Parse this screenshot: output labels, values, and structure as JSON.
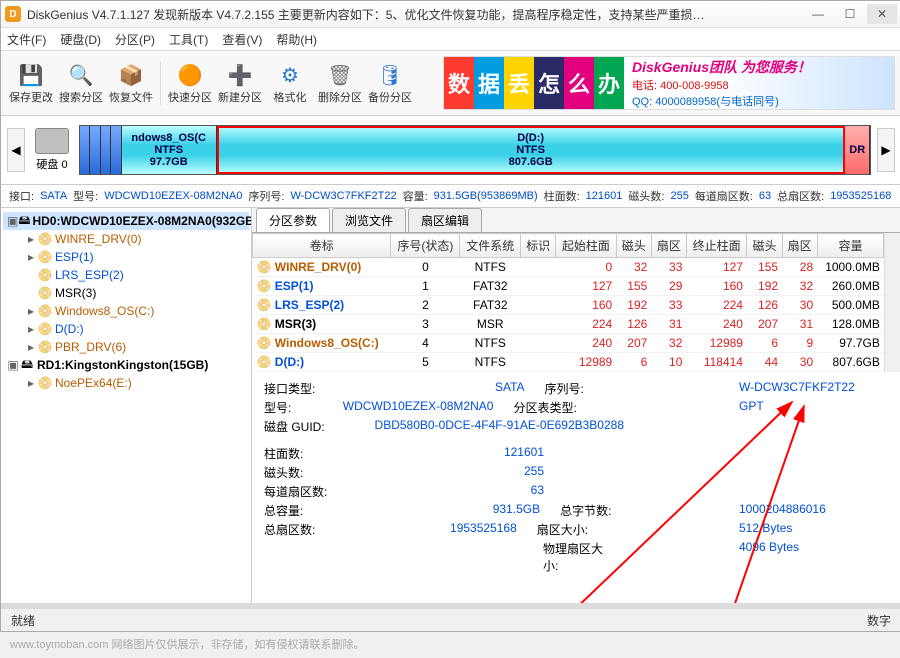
{
  "title": "DiskGenius V4.7.1.127   发现新版本 V4.7.2.155 主要更新内容如下：5、优化文件恢复功能，提高程序稳定性，支持某些严重损…",
  "menu": [
    "文件(F)",
    "硬盘(D)",
    "分区(P)",
    "工具(T)",
    "查看(V)",
    "帮助(H)"
  ],
  "toolbar": [
    {
      "label": "保存更改",
      "color": "#188a00",
      "glyph": "💾"
    },
    {
      "label": "搜索分区",
      "color": "#d76b00",
      "glyph": "🔍"
    },
    {
      "label": "恢复文件",
      "color": "#8a3a00",
      "glyph": "📦"
    },
    {
      "label": "快速分区",
      "color": "#d76b00",
      "glyph": "🟠"
    },
    {
      "label": "新建分区",
      "color": "#2a7ad1",
      "glyph": "➕"
    },
    {
      "label": "格式化",
      "color": "#2a7ad1",
      "glyph": "⚙"
    },
    {
      "label": "删除分区",
      "color": "#777",
      "glyph": "🗑"
    },
    {
      "label": "备份分区",
      "color": "#2a7ad1",
      "glyph": "🛢"
    }
  ],
  "banner": {
    "chars": [
      {
        "t": "数",
        "bg": "#ff3b30"
      },
      {
        "t": "据",
        "bg": "#009de0"
      },
      {
        "t": "丢",
        "bg": "#ffd400"
      },
      {
        "t": "怎",
        "bg": "#2a2a66"
      },
      {
        "t": "么",
        "bg": "#e3007e"
      },
      {
        "t": "办",
        "bg": "#00a651"
      }
    ],
    "l1": "DiskGenius团队 为您服务！",
    "l2": "电话: 400-008-9958",
    "l3": "QQ: 4000089958(与电话同号)"
  },
  "disklabel": "硬盘 0",
  "segments": [
    {
      "name": "",
      "sub": "",
      "w": "1.2%",
      "cls": "small"
    },
    {
      "name": "",
      "sub": "",
      "w": "1.2%",
      "cls": "small"
    },
    {
      "name": "",
      "sub": "",
      "w": "1.2%",
      "cls": "small"
    },
    {
      "name": "",
      "sub": "",
      "w": "1.2%",
      "cls": "small"
    },
    {
      "name": "ndows8_OS(C",
      "sub": "NTFS",
      "size": "97.7GB",
      "w": "12%",
      "cls": ""
    },
    {
      "name": "D(D:)",
      "sub": "NTFS",
      "size": "807.6GB",
      "w": "80%",
      "cls": "sel"
    },
    {
      "name": "DR",
      "sub": "",
      "size": "",
      "w": "3%",
      "cls": "end"
    }
  ],
  "infoline": {
    "iface_l": "接口:",
    "iface": "SATA",
    "model_l": "型号:",
    "model": "WDCWD10EZEX-08M2NA0",
    "serial_l": "序列号:",
    "serial": "W-DCW3C7FKF2T22",
    "cap_l": "容量:",
    "cap": "931.5GB(953869MB)",
    "cyl_l": "柱面数:",
    "cyl": "121601",
    "head_l": "磁头数:",
    "head": "255",
    "spt_l": "每道扇区数:",
    "spt": "63",
    "tot_l": "总扇区数:",
    "tot": "1953525168"
  },
  "tree": [
    {
      "ind": 0,
      "tw": "▣",
      "ic": "🖴",
      "txt": "HD0:WDCWD10EZEX-08M2NA0(932GB)",
      "bold": true,
      "sel": true
    },
    {
      "ind": 1,
      "tw": "▸",
      "ic": "📀",
      "txt": "WINRE_DRV(0)",
      "color": "#b85c00"
    },
    {
      "ind": 1,
      "tw": "▸",
      "ic": "📀",
      "txt": "ESP(1)",
      "color": "#0050d8"
    },
    {
      "ind": 1,
      "tw": "",
      "ic": "📀",
      "txt": "LRS_ESP(2)",
      "color": "#0050d8"
    },
    {
      "ind": 1,
      "tw": "",
      "ic": "📀",
      "txt": "MSR(3)",
      "color": "#000"
    },
    {
      "ind": 1,
      "tw": "▸",
      "ic": "📀",
      "txt": "Windows8_OS(C:)",
      "color": "#b85c00"
    },
    {
      "ind": 1,
      "tw": "▸",
      "ic": "📀",
      "txt": "D(D:)",
      "color": "#0050d8"
    },
    {
      "ind": 1,
      "tw": "▸",
      "ic": "📀",
      "txt": "PBR_DRV(6)",
      "color": "#b85c00"
    },
    {
      "ind": 0,
      "tw": "▣",
      "ic": "🖴",
      "txt": "RD1:KingstonKingston(15GB)",
      "bold": true
    },
    {
      "ind": 1,
      "tw": "▸",
      "ic": "📀",
      "txt": "NoePEx64(E:)",
      "color": "#b85c00"
    }
  ],
  "tabs": [
    "分区参数",
    "浏览文件",
    "扇区编辑"
  ],
  "cols": [
    "卷标",
    "序号(状态)",
    "文件系统",
    "标识",
    "起始柱面",
    "磁头",
    "扇区",
    "终止柱面",
    "磁头",
    "扇区",
    "容量"
  ],
  "rows": [
    {
      "n": "WINRE_DRV(0)",
      "c": "#b85c00",
      "seq": "0",
      "fs": "NTFS",
      "id": "",
      "sc": "0",
      "sh": "32",
      "ss": "33",
      "ec": "127",
      "eh": "155",
      "es": "28",
      "cap": "1000.0MB"
    },
    {
      "n": "ESP(1)",
      "c": "#0050d8",
      "seq": "1",
      "fs": "FAT32",
      "id": "",
      "sc": "127",
      "sh": "155",
      "ss": "29",
      "ec": "160",
      "eh": "192",
      "es": "32",
      "cap": "260.0MB"
    },
    {
      "n": "LRS_ESP(2)",
      "c": "#0050d8",
      "seq": "2",
      "fs": "FAT32",
      "id": "",
      "sc": "160",
      "sh": "192",
      "ss": "33",
      "ec": "224",
      "eh": "126",
      "es": "30",
      "cap": "500.0MB"
    },
    {
      "n": "MSR(3)",
      "c": "#000",
      "seq": "3",
      "fs": "MSR",
      "id": "",
      "sc": "224",
      "sh": "126",
      "ss": "31",
      "ec": "240",
      "eh": "207",
      "es": "31",
      "cap": "128.0MB"
    },
    {
      "n": "Windows8_OS(C:)",
      "c": "#b85c00",
      "seq": "4",
      "fs": "NTFS",
      "id": "",
      "sc": "240",
      "sh": "207",
      "ss": "32",
      "ec": "12989",
      "eh": "6",
      "es": "9",
      "cap": "97.7GB"
    },
    {
      "n": "D(D:)",
      "c": "#0050d8",
      "seq": "5",
      "fs": "NTFS",
      "id": "",
      "sc": "12989",
      "sh": "6",
      "ss": "10",
      "ec": "118414",
      "eh": "44",
      "es": "30",
      "cap": "807.6GB"
    }
  ],
  "det": {
    "l1a": "接口类型:",
    "v1a": "SATA",
    "l1b": "序列号:",
    "v1b": "W-DCW3C7FKF2T22",
    "l2a": "型号:",
    "v2a": "WDCWD10EZEX-08M2NA0",
    "l2b": "分区表类型:",
    "v2b": "GPT",
    "l3a": "磁盘 GUID:",
    "v3a": "DBD580B0-0DCE-4F4F-91AE-0E692B3B0288",
    "l4": "柱面数:",
    "v4": "121601",
    "l5": "磁头数:",
    "v5": "255",
    "l6": "每道扇区数:",
    "v6": "63",
    "l7": "总容量:",
    "v7": "931.5GB",
    "l7b": "总字节数:",
    "v7b": "1000204886016",
    "l8": "总扇区数:",
    "v8": "1953525168",
    "l8b": "扇区大小:",
    "v8b": "512 Bytes",
    "l9b": "物理扇区大小:",
    "v9b": "4096 Bytes"
  },
  "status": {
    "l": "就绪",
    "r": "数字"
  },
  "watermark": "www.toymoban.com   网络图片仅供展示，非存储，如有侵权请联系删除。"
}
